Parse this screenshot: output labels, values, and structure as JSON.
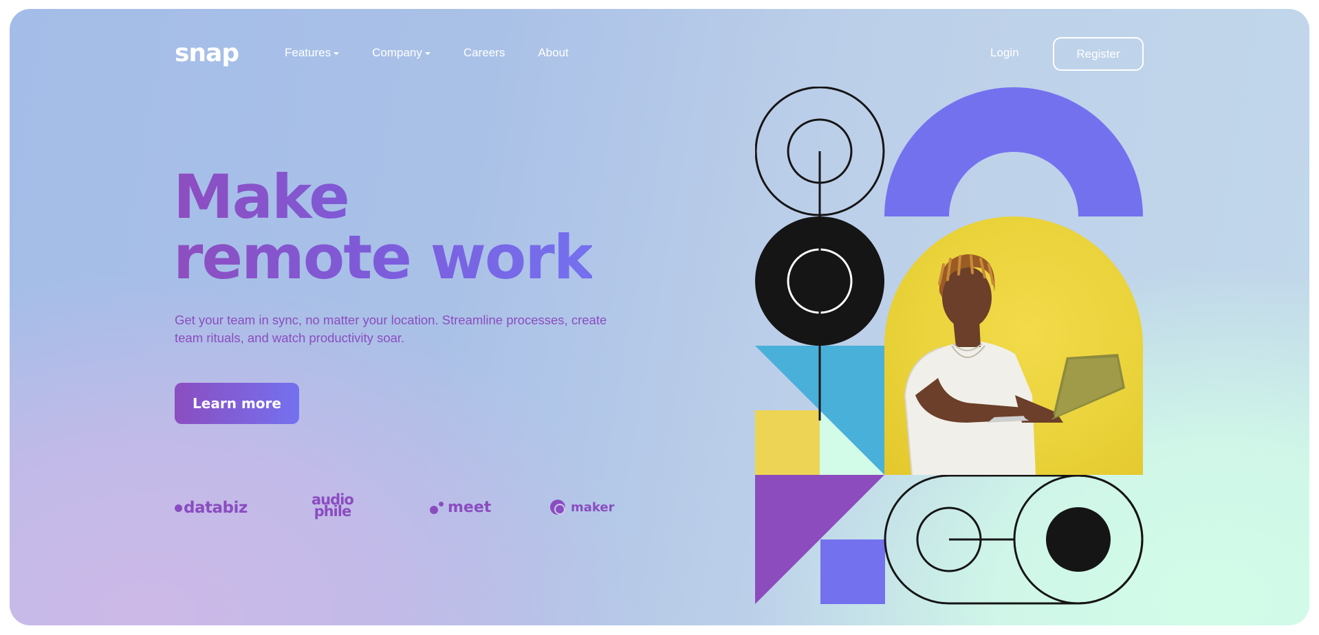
{
  "brand": {
    "logo_text": "snap"
  },
  "nav": {
    "items": [
      {
        "label": "Features",
        "dropdown": true
      },
      {
        "label": "Company",
        "dropdown": true
      },
      {
        "label": "Careers",
        "dropdown": false
      },
      {
        "label": "About",
        "dropdown": false
      }
    ],
    "login_label": "Login",
    "register_label": "Register"
  },
  "hero": {
    "headline_line1": "Make",
    "headline_line2": "remote work",
    "subtext": "Get your team in sync, no matter your location. Streamline processes, create team rituals, and watch productivity soar.",
    "cta_label": "Learn more"
  },
  "clients": {
    "databiz": "databiz",
    "audio_line1": "audio",
    "audio_line2": "phile",
    "meet": "meet",
    "maker": "maker"
  },
  "colors": {
    "accent_purple": "#8a4dc0",
    "accent_violet": "#7471ef",
    "yellow": "#edd455",
    "sky_blue": "#49b0d9",
    "mint": "#d2fbe8",
    "black": "#151515"
  },
  "illustration": {
    "icon": "man-with-laptop-illustration"
  }
}
